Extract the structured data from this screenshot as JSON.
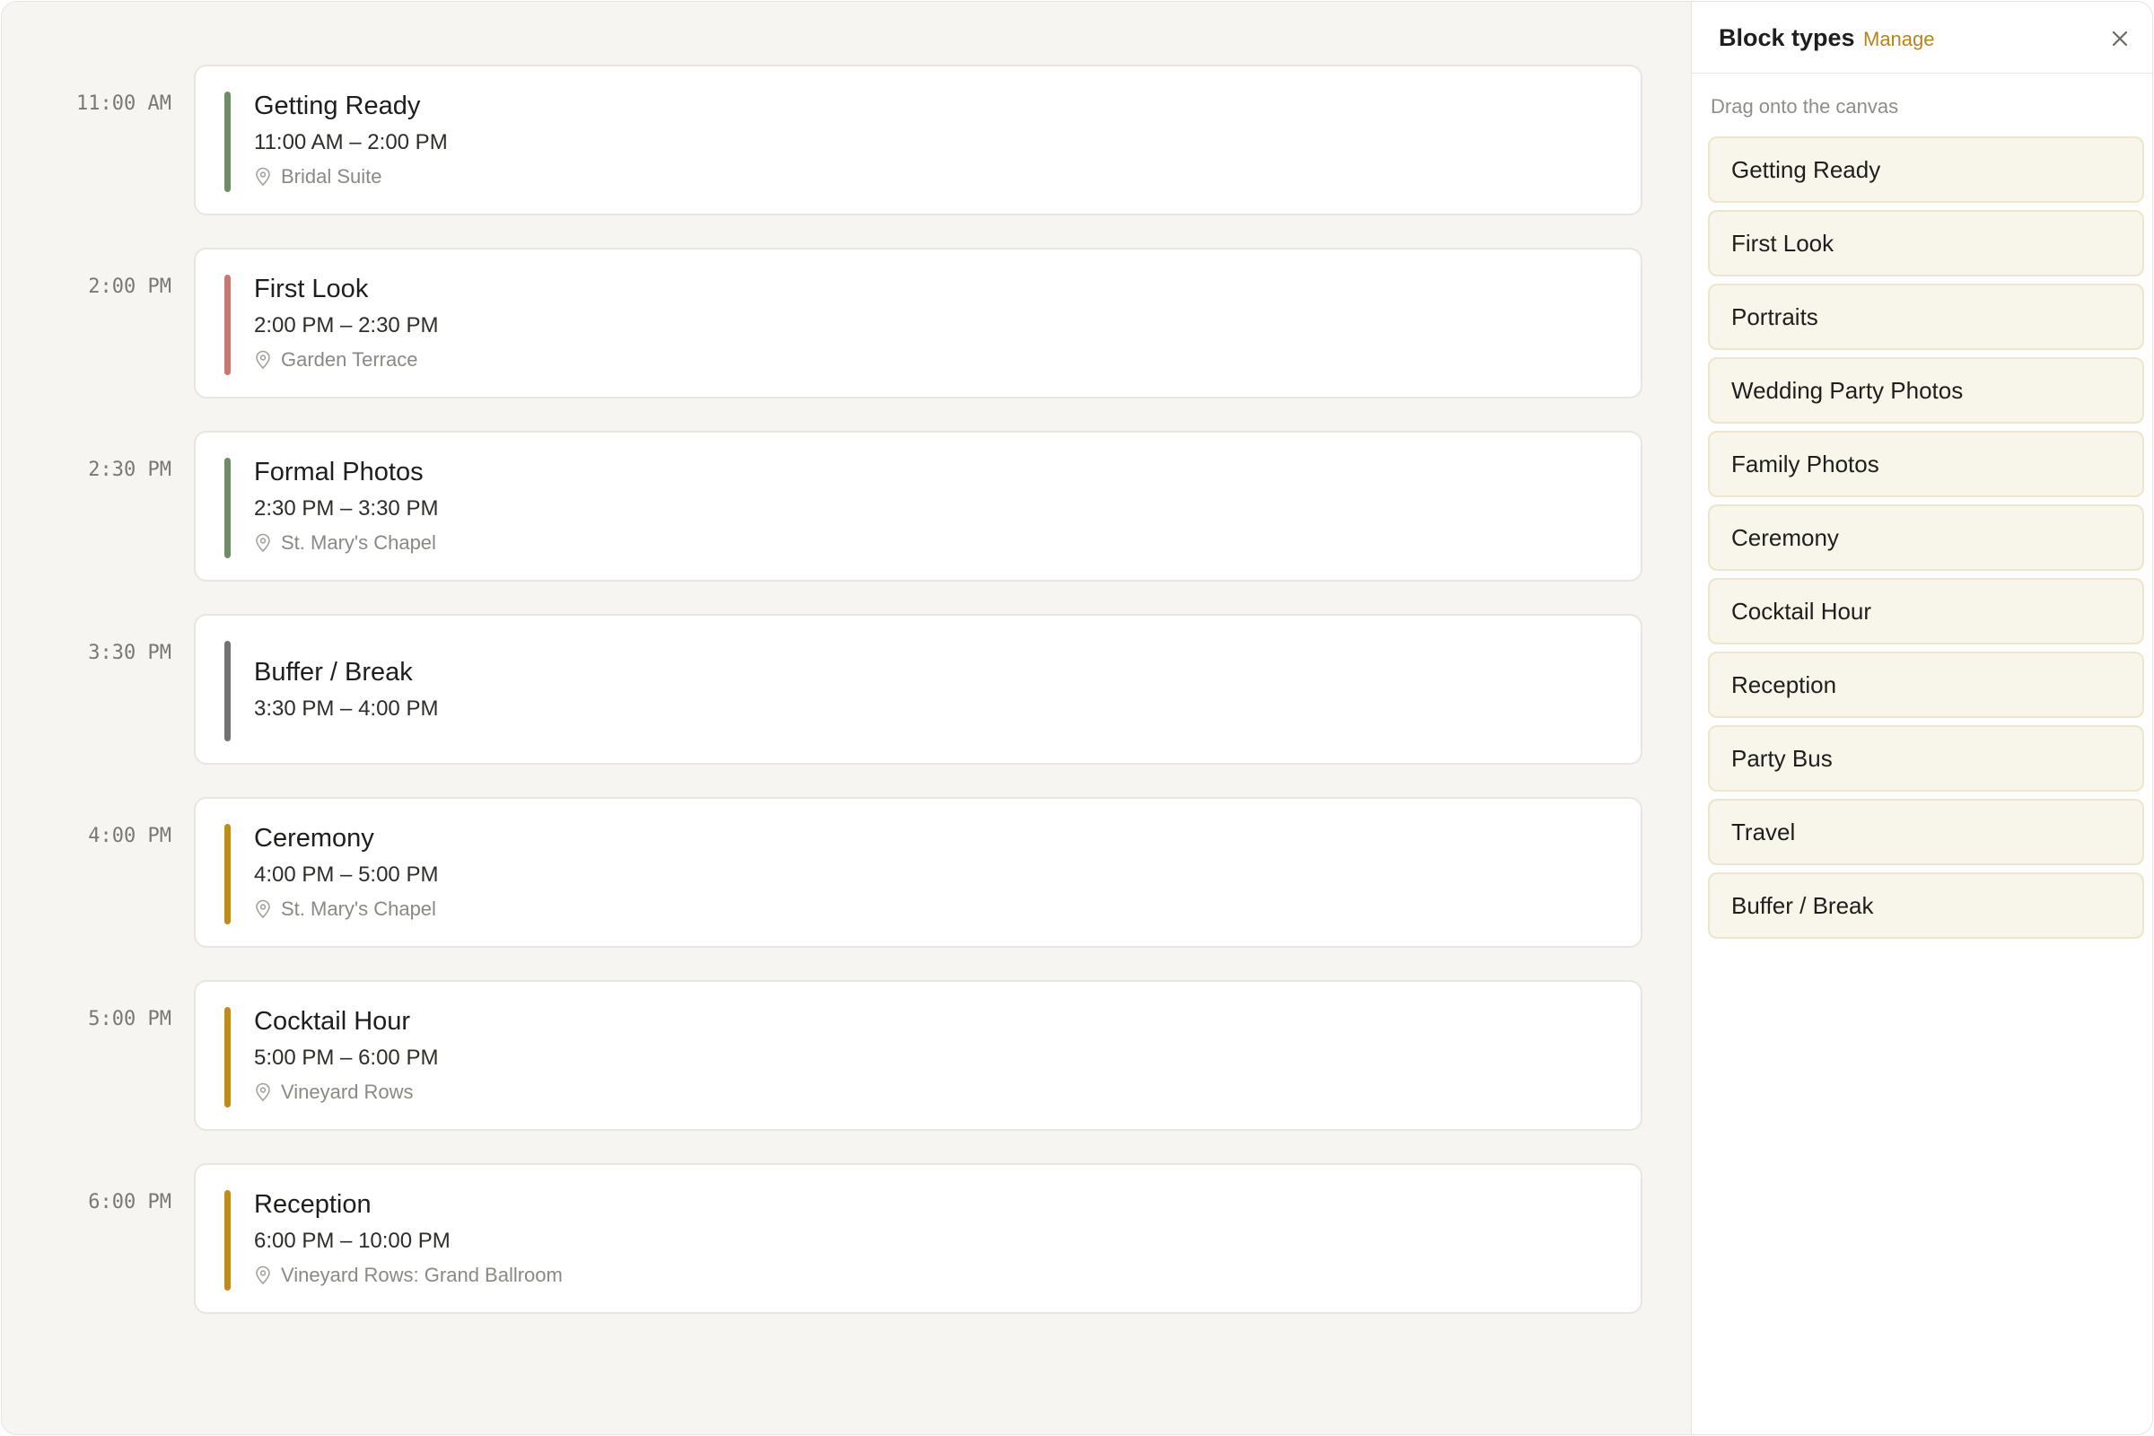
{
  "timeline": {
    "blocks": [
      {
        "time_label": "11:00 AM",
        "title": "Getting Ready",
        "time_range": "11:00 AM – 2:00 PM",
        "location": "Bridal Suite",
        "color": "#6f8c69"
      },
      {
        "time_label": "2:00 PM",
        "title": "First Look",
        "time_range": "2:00 PM – 2:30 PM",
        "location": "Garden Terrace",
        "color": "#c97771"
      },
      {
        "time_label": "2:30 PM",
        "title": "Formal Photos",
        "time_range": "2:30 PM – 3:30 PM",
        "location": "St. Mary's Chapel",
        "color": "#6f8c69"
      },
      {
        "time_label": "3:30 PM",
        "title": "Buffer / Break",
        "time_range": "3:30 PM – 4:00 PM",
        "location": "",
        "color": "#757370"
      },
      {
        "time_label": "4:00 PM",
        "title": "Ceremony",
        "time_range": "4:00 PM – 5:00 PM",
        "location": "St. Mary's Chapel",
        "color": "#bf8a25"
      },
      {
        "time_label": "5:00 PM",
        "title": "Cocktail Hour",
        "time_range": "5:00 PM – 6:00 PM",
        "location": "Vineyard Rows",
        "color": "#bf8a25"
      },
      {
        "time_label": "6:00 PM",
        "title": "Reception",
        "time_range": "6:00 PM – 10:00 PM",
        "location": "Vineyard Rows: Grand Ballroom",
        "color": "#bf8a25"
      }
    ]
  },
  "panel": {
    "title": "Block types",
    "manage_label": "Manage",
    "close_icon": "close-icon",
    "hint": "Drag onto the canvas",
    "items": [
      {
        "label": "Getting Ready"
      },
      {
        "label": "First Look"
      },
      {
        "label": "Portraits"
      },
      {
        "label": "Wedding Party Photos"
      },
      {
        "label": "Family Photos"
      },
      {
        "label": "Ceremony"
      },
      {
        "label": "Cocktail Hour"
      },
      {
        "label": "Reception"
      },
      {
        "label": "Party Bus"
      },
      {
        "label": "Travel"
      },
      {
        "label": "Buffer / Break"
      }
    ]
  },
  "colors": {
    "accent": "#b28424",
    "canvas_bg": "#f6f5f2",
    "palette_bg": "#f8f5ea"
  }
}
